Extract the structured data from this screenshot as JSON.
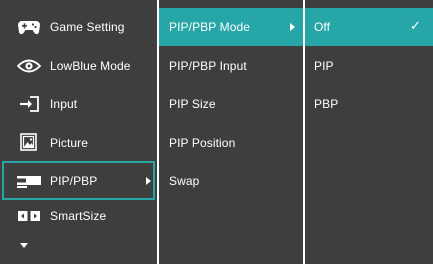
{
  "main_menu": {
    "items": [
      {
        "label": "Game Setting",
        "icon": "gamepad-icon"
      },
      {
        "label": "LowBlue Mode",
        "icon": "eye-icon"
      },
      {
        "label": "Input",
        "icon": "input-arrow-icon"
      },
      {
        "label": "Picture",
        "icon": "picture-icon"
      },
      {
        "label": "PIP/PBP",
        "icon": "pip-pbp-icon"
      },
      {
        "label": "SmartSize",
        "icon": "smartsize-icon"
      }
    ],
    "selected": "PIP/PBP",
    "more_indicator": "chevron-down-icon"
  },
  "submenu": {
    "items": [
      {
        "label": "PIP/PBP Mode"
      },
      {
        "label": "PIP/PBP Input"
      },
      {
        "label": "PIP Size"
      },
      {
        "label": "PIP Position"
      },
      {
        "label": "Swap"
      }
    ],
    "selected": "PIP/PBP Mode"
  },
  "options": {
    "items": [
      {
        "label": "Off",
        "checked": true
      },
      {
        "label": "PIP",
        "checked": false
      },
      {
        "label": "PBP",
        "checked": false
      }
    ],
    "check_mark": "✓"
  },
  "colors": {
    "panel_bg": "#3e3e3e",
    "accent": "#26a6a6",
    "separator": "#ffffff",
    "text": "#ffffff"
  }
}
